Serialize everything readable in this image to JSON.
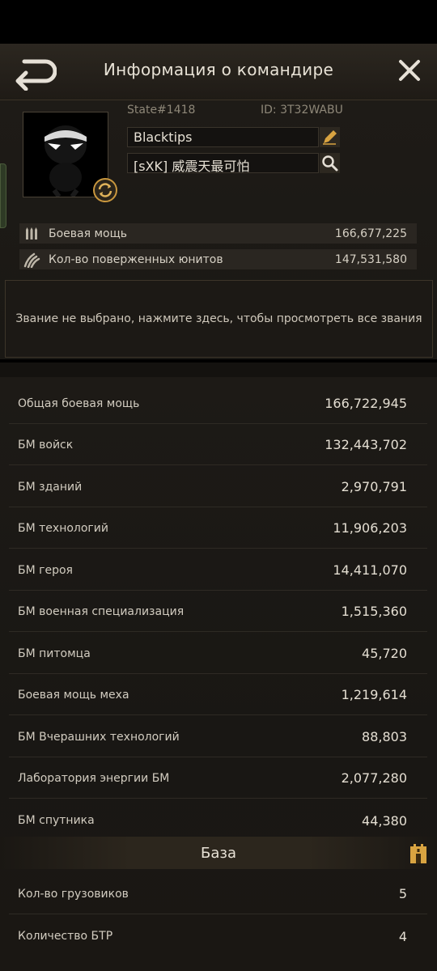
{
  "header": {
    "title": "Информация о командире"
  },
  "profile": {
    "state": "State#1418",
    "id": "ID: 3T32WABU",
    "name": "Blacktips",
    "alliance": "[sXK] 威震天最可怕"
  },
  "summary": [
    {
      "label": "Боевая мощь",
      "value": "166,677,225",
      "icon": "bullets-icon"
    },
    {
      "label": "Кол-во поверженных юнитов",
      "value": "147,531,580",
      "icon": "claw-icon"
    }
  ],
  "title_prompt": "Звание не выбрано, нажмите здесь, чтобы просмотреть все звания",
  "power_rows": [
    {
      "label": "Общая боевая мощь",
      "value": "166,722,945"
    },
    {
      "label": "БМ войск",
      "value": "132,443,702"
    },
    {
      "label": "БМ зданий",
      "value": "2,970,791"
    },
    {
      "label": "БМ технологий",
      "value": "11,906,203"
    },
    {
      "label": "БМ героя",
      "value": "14,411,070"
    },
    {
      "label": "БМ военная специализация",
      "value": "1,515,360"
    },
    {
      "label": "БМ питомца",
      "value": "45,720"
    },
    {
      "label": "Боевая мощь меха",
      "value": "1,219,614"
    },
    {
      "label": "БМ Вчерашних технологий",
      "value": "88,803"
    },
    {
      "label": "Лаборатория энергии БМ",
      "value": "2,077,280"
    },
    {
      "label": "БМ спутника",
      "value": "44,380"
    }
  ],
  "base_section": {
    "title": "База",
    "rows": [
      {
        "label": "Кол-во грузовиков",
        "value": "5"
      },
      {
        "label": "Количество БТР",
        "value": "4"
      }
    ]
  },
  "colors": {
    "accent": "#d9a441",
    "background": "#1a1814",
    "text": "#d8d2c6"
  }
}
